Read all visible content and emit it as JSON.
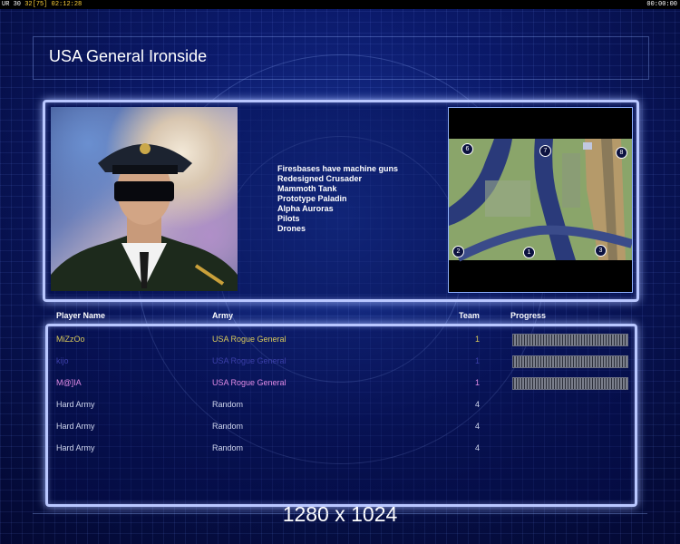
{
  "hud": {
    "left_prefix": "UR 30 ",
    "left_fps": "32[75]",
    "left_time": "02:12:28",
    "right_time": "00:00:00"
  },
  "title": "USA General Ironside",
  "features": [
    "Firesbases have machine guns",
    "Redesigned Crusader",
    "Mammoth Tank",
    "Prototype Paladin",
    "Alpha Auroras",
    "Pilots",
    "Drones"
  ],
  "minimap": {
    "start_positions": [
      "6",
      "7",
      "8",
      "2",
      "1",
      "3"
    ]
  },
  "table": {
    "headers": {
      "player_name": "Player Name",
      "army": "Army",
      "team": "Team",
      "progress": "Progress"
    },
    "rows": [
      {
        "name": "MiZzOo",
        "army": "USA Rogue General",
        "team": "1",
        "name_color": "#d9c95a",
        "army_color": "#d9c95a",
        "team_color": "#d9c95a",
        "has_progress": true
      },
      {
        "name": "kijo",
        "army": "USA Rogue General",
        "team": "1",
        "name_color": "#3b3fa8",
        "army_color": "#3b3fa8",
        "team_color": "#3b3fa8",
        "has_progress": true
      },
      {
        "name": "M@]IA",
        "army": "USA Rogue General",
        "team": "1",
        "name_color": "#e18be6",
        "army_color": "#e18be6",
        "team_color": "#e18be6",
        "has_progress": true
      },
      {
        "name": "Hard Army",
        "army": "Random",
        "team": "4",
        "name_color": "#cfd6ee",
        "army_color": "#cfd6ee",
        "team_color": "#cfd6ee",
        "has_progress": false
      },
      {
        "name": "Hard Army",
        "army": "Random",
        "team": "4",
        "name_color": "#cfd6ee",
        "army_color": "#cfd6ee",
        "team_color": "#cfd6ee",
        "has_progress": false
      },
      {
        "name": "Hard Army",
        "army": "Random",
        "team": "4",
        "name_color": "#cfd6ee",
        "army_color": "#cfd6ee",
        "team_color": "#cfd6ee",
        "has_progress": false
      }
    ]
  },
  "resolution": "1280 x 1024"
}
